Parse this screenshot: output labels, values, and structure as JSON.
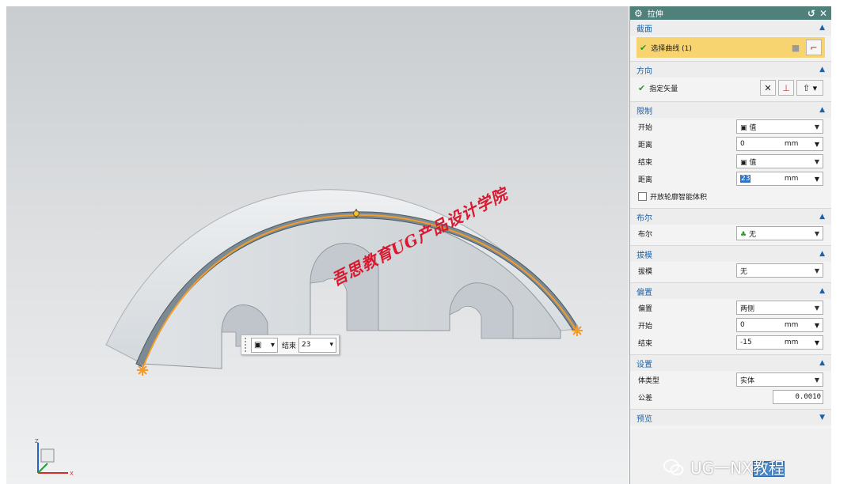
{
  "dialog": {
    "title": "拉伸",
    "icons": {
      "title": "gear-icon",
      "reset": "reset-icon",
      "close": "close-icon"
    },
    "sections": {
      "section_curve": {
        "label": "截面",
        "select_label": "选择曲线 (1)"
      },
      "direction": {
        "label": "方向",
        "vector_label": "指定矢量"
      },
      "limits": {
        "label": "限制",
        "start_label": "开始",
        "start_type": "值",
        "start_dist_label": "距离",
        "start_dist": "0",
        "start_unit": "mm",
        "end_label": "结束",
        "end_type": "值",
        "end_dist_label": "距离",
        "end_dist": "23",
        "end_unit": "mm",
        "open_profile_label": "开放轮廓智能体积"
      },
      "boolean": {
        "label": "布尔",
        "field_label": "布尔",
        "value": "无"
      },
      "draft": {
        "label": "拔模",
        "field_label": "拔模",
        "value": "无"
      },
      "offset": {
        "label": "偏置",
        "type_label": "偏置",
        "type_value": "两侧",
        "start_label": "开始",
        "start_value": "0",
        "start_unit": "mm",
        "end_label": "结束",
        "end_value": "-15",
        "end_unit": "mm"
      },
      "settings": {
        "label": "设置",
        "body_type_label": "体类型",
        "body_type": "实体",
        "tolerance_label": "公差",
        "tolerance": "0.0010"
      },
      "preview": {
        "label": "预览"
      }
    }
  },
  "viewport": {
    "watermark": "吾思教育UG产品设计学院",
    "handle": {
      "label": "结束",
      "value": "23"
    },
    "axes": {
      "x": "X",
      "z": "Z"
    }
  },
  "brand": {
    "text": "UG一NX教程"
  },
  "colors": {
    "accent": "#4f807a",
    "highlight": "#f8d470",
    "curve": "#f39c2e",
    "section_header": "#1f62a6"
  }
}
